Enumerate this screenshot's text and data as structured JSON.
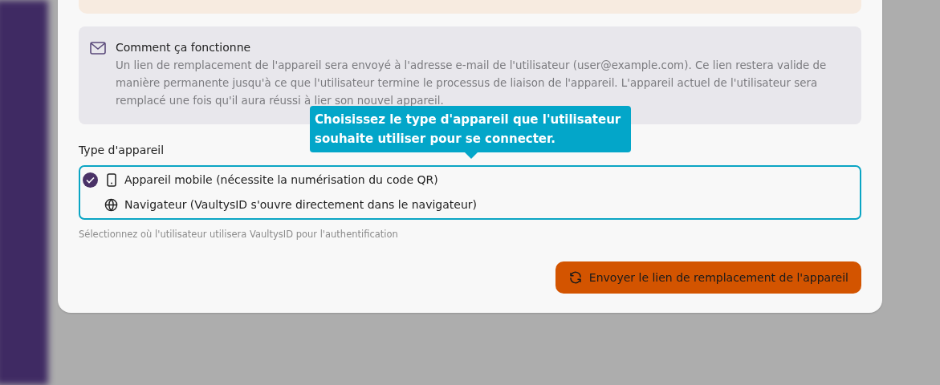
{
  "info": {
    "title": "Comment ça fonctionne",
    "text": "Un lien de remplacement de l'appareil sera envoyé à l'adresse e-mail de l'utilisateur (user@example.com). Ce lien restera valide de manière permanente jusqu'à ce que l'utilisateur termine le processus de liaison de l'appareil. L'appareil actuel de l'utilisateur sera remplacé une fois qu'il aura réussi à lier son nouvel appareil."
  },
  "tooltip": {
    "text": "Choisissez le type d'appareil que l'utilisateur souhaite utiliser pour se connecter."
  },
  "device_type": {
    "label": "Type d'appareil",
    "options": [
      {
        "kind": "mobile",
        "label": "Appareil mobile (nécessite la numérisation du code QR)",
        "selected": true
      },
      {
        "kind": "browser",
        "label": "Navigateur (VaultysID s'ouvre directement dans le navigateur)",
        "selected": false
      }
    ],
    "hint": "Sélectionnez où l'utilisateur utilisera VaultysID pour l'authentification"
  },
  "submit_button": {
    "label": "Envoyer le lien de remplacement de l'appareil"
  }
}
